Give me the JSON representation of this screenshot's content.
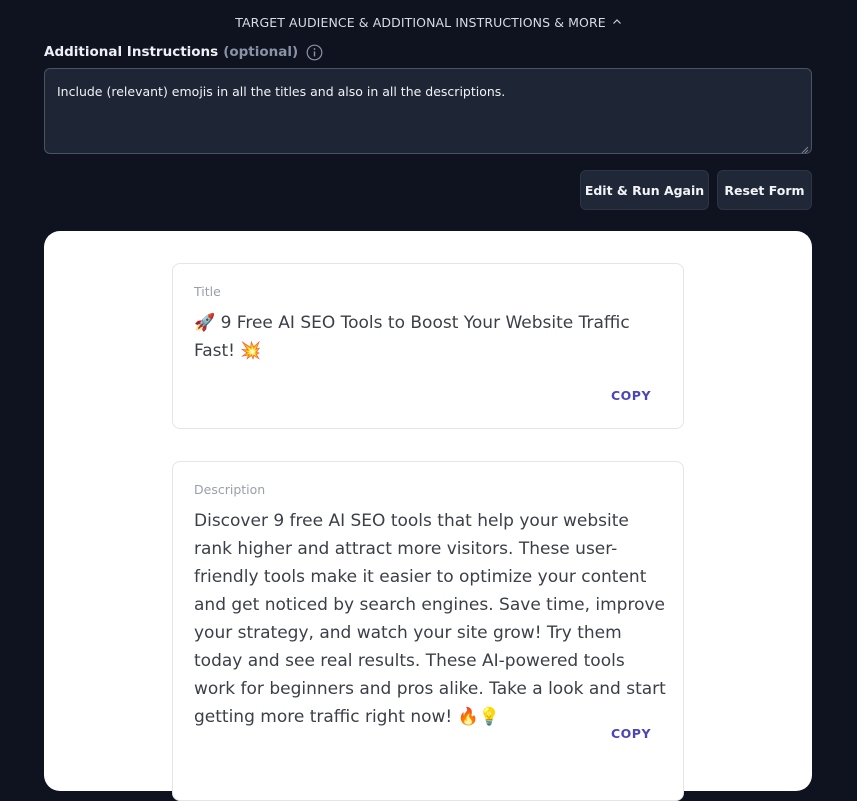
{
  "section_toggle": {
    "label": "TARGET AUDIENCE & ADDITIONAL INSTRUCTIONS & MORE",
    "icon": "chevron-up-icon"
  },
  "additional_instructions": {
    "label": "Additional Instructions",
    "optional_label": "(optional)",
    "info_icon": "info-icon",
    "value": "Include (relevant) emojis in all the titles and also in all the descriptions."
  },
  "actions": {
    "edit_run_again": "Edit & Run Again",
    "reset_form": "Reset Form"
  },
  "results": {
    "title_card": {
      "label": "Title",
      "text": "🚀 9 Free AI SEO Tools to Boost Your Website Traffic Fast! 💥",
      "copy_label": "COPY"
    },
    "description_card": {
      "label": "Description",
      "text": "Discover 9 free AI SEO tools that help your website rank higher and attract more visitors. These user-friendly tools make it easier to optimize your content and get noticed by search engines. Save time, improve your strategy, and watch your site grow! Try them today and see real results. These AI-powered tools work for beginners and pros alike. Take a look and start getting more traffic right now! 🔥💡",
      "copy_label": "COPY"
    }
  },
  "colors": {
    "page_background": "#0f1320",
    "input_background": "#1e2535",
    "button_background": "#202838",
    "copy_accent": "#4b45b8"
  }
}
